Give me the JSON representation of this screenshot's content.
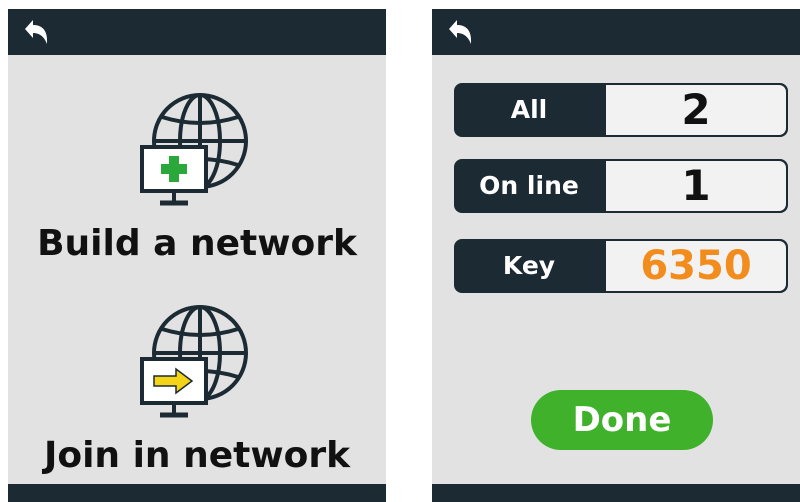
{
  "left_screen": {
    "back_icon": "back-arrow-icon",
    "menu": [
      {
        "label": "Build a network",
        "icon": "globe-monitor-plus-icon",
        "badge_color": "#2aa83a"
      },
      {
        "label": "Join in network",
        "icon": "globe-monitor-arrow-icon",
        "badge_color": "#f4d418"
      }
    ]
  },
  "right_screen": {
    "back_icon": "back-arrow-icon",
    "rows": [
      {
        "label": "All",
        "value": "2"
      },
      {
        "label": "On line",
        "value": "1"
      },
      {
        "label": "Key",
        "value": "6350",
        "value_color": "#f28c1c"
      }
    ],
    "done_label": "Done"
  },
  "colors": {
    "bar": "#1b2a33",
    "background": "#e2e2e2",
    "accent_green": "#40b12a",
    "key_orange": "#f28c1c"
  }
}
